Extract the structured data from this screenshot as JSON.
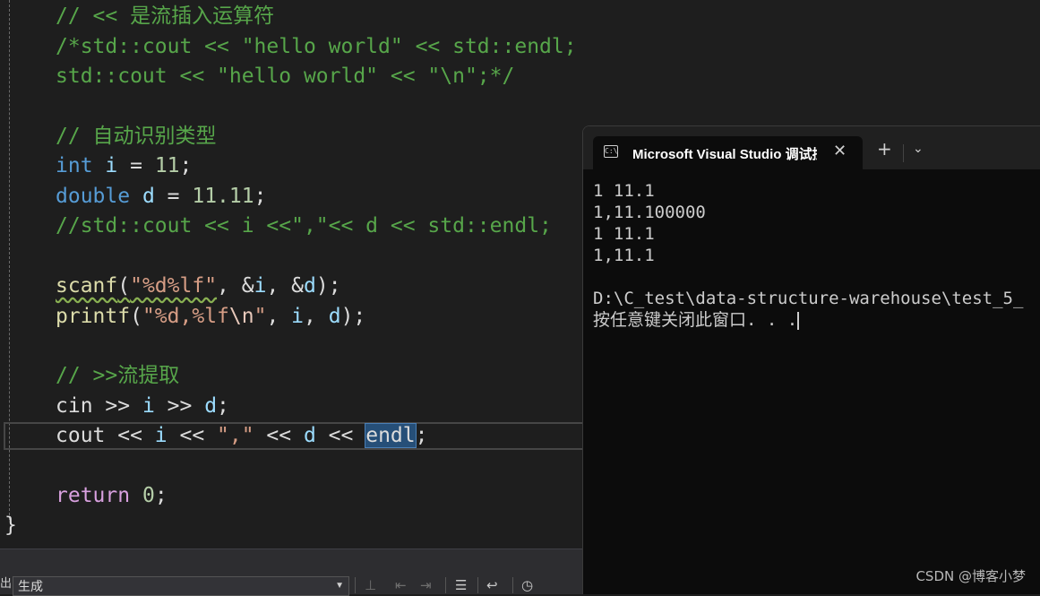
{
  "editor": {
    "comment_stream_insert": "// << 是流插入运算符",
    "comment_block_1": "/*std::cout << \"hello world\" << std::endl;",
    "comment_block_2": "std::cout << \"hello world\" << \"\\n\";*/",
    "comment_auto_type": "// 自动识别类型",
    "int_kw": "int",
    "int_var": "i",
    "int_eq": " = ",
    "int_val": "11",
    "semi": ";",
    "double_kw": "double",
    "double_var": "d",
    "double_val": "11.11",
    "comment_cout": "//std::cout << i <<\",\"<< d << std::endl;",
    "scanf_fn": "scanf",
    "scanf_fmt": "\"%d%lf\"",
    "scanf_args_1": ", &",
    "scanf_args_2": ", &",
    "scanf_end": ");",
    "printf_fn": "printf",
    "printf_fmt": "\"%d,%lf",
    "printf_esc": "\\n",
    "printf_quote": "\"",
    "printf_sep": ", ",
    "printf_end": ");",
    "comment_extract": "// >>流提取",
    "cin_kw": "cin",
    "op_extract": " >> ",
    "cout_kw": "cout",
    "op_insert": " << ",
    "comma_str": "\",\"",
    "endl_kw": "endl",
    "return_kw": "return",
    "return_val": "0",
    "closing_brace": "}",
    "open_paren": "(",
    "comma": ", ",
    "space": " "
  },
  "bottom_bar": {
    "output_label": "出:",
    "build_select": "生成"
  },
  "terminal": {
    "tab_title": "Microsoft Visual Studio 调试控制台",
    "tab_icon_text": "C:\\",
    "close_glyph": "✕",
    "plus_glyph": "+",
    "chevron_glyph": "⌄",
    "lines": [
      "1 11.1",
      "1,11.100000",
      "1 11.1",
      "1,11.1",
      "",
      "D:\\C_test\\data-structure-warehouse\\test_5_",
      "按任意键关闭此窗口. . ."
    ]
  },
  "watermark": "CSDN @博客小梦",
  "colors": {
    "editor_bg": "#1e1e1e",
    "comment": "#57a64a",
    "keyword": "#569cd6",
    "variable": "#9cdcfe",
    "number": "#b5cea8",
    "string": "#d69d85",
    "function": "#dcdcaa",
    "control": "#d8a0df",
    "terminal_bg": "#0c0c0c"
  }
}
